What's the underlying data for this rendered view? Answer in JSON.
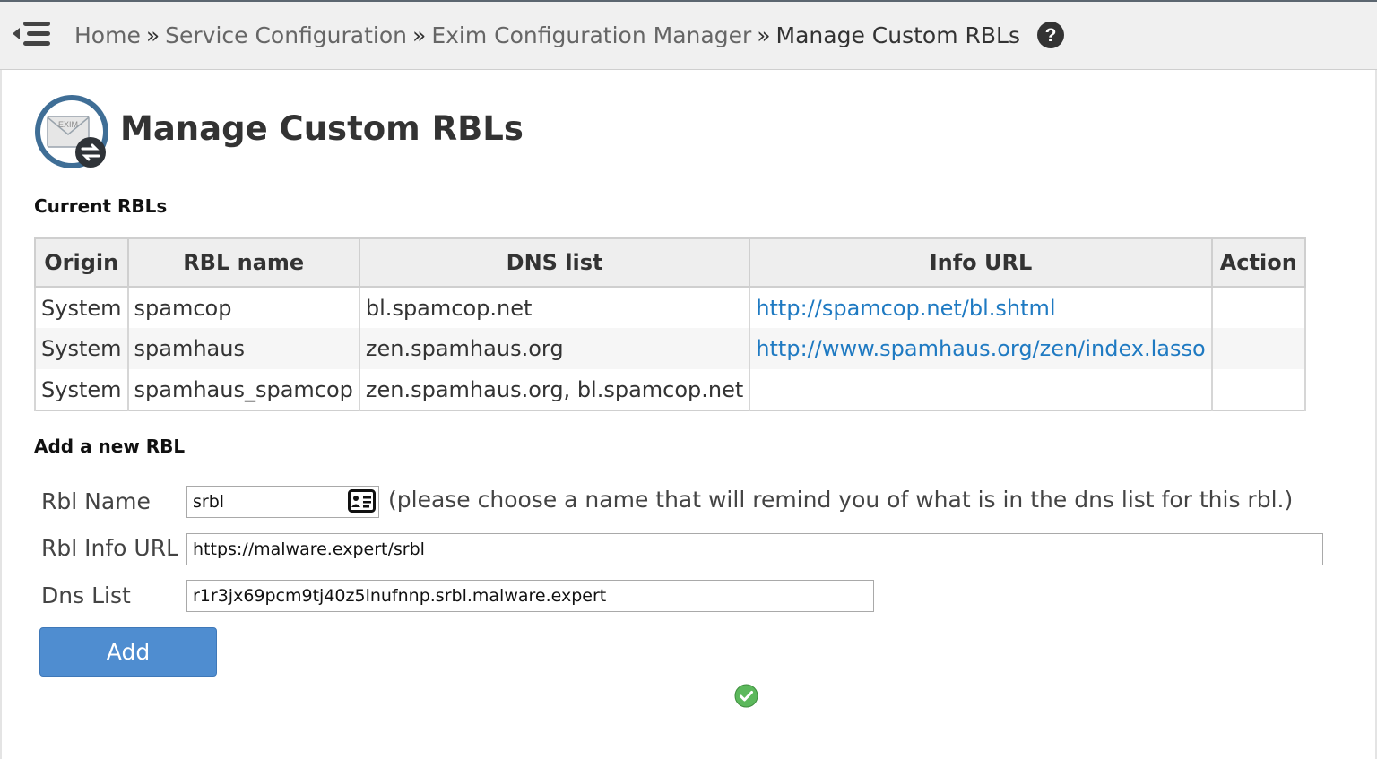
{
  "breadcrumb": {
    "home": "Home",
    "service_config": "Service Configuration",
    "exim_manager": "Exim Configuration Manager",
    "current": "Manage Custom RBLs",
    "separator": "»"
  },
  "page": {
    "title": "Manage Custom RBLs",
    "icon_text": "EXIM"
  },
  "current_rbls": {
    "heading": "Current RBLs",
    "columns": [
      "Origin",
      "RBL name",
      "DNS list",
      "Info URL",
      "Action"
    ],
    "rows": [
      {
        "origin": "System",
        "name": "spamcop",
        "dns": "bl.spamcop.net",
        "url": "http://spamcop.net/bl.shtml",
        "action": ""
      },
      {
        "origin": "System",
        "name": "spamhaus",
        "dns": "zen.spamhaus.org",
        "url": "http://www.spamhaus.org/zen/index.lasso",
        "action": ""
      },
      {
        "origin": "System",
        "name": "spamhaus_spamcop",
        "dns": "zen.spamhaus.org, bl.spamcop.net",
        "url": "",
        "action": ""
      }
    ]
  },
  "add_form": {
    "heading": "Add a new RBL",
    "name_label": "Rbl Name",
    "name_value": "srbl",
    "name_hint": "(please choose a name that will remind you of what is in the dns list for this rbl.)",
    "url_label": "Rbl Info URL",
    "url_value": "https://malware.expert/srbl",
    "dns_label": "Dns List",
    "dns_value": "r1r3jx69pcm9tj40z5lnufnnp.srbl.malware.expert",
    "add_button": "Add"
  },
  "colors": {
    "link": "#1f7ac2",
    "button": "#4f8dd0",
    "success": "#5cb85c"
  },
  "icons": [
    "menu-collapse-icon",
    "help-icon",
    "exim-logo-icon",
    "contact-card-icon",
    "success-check-icon"
  ]
}
